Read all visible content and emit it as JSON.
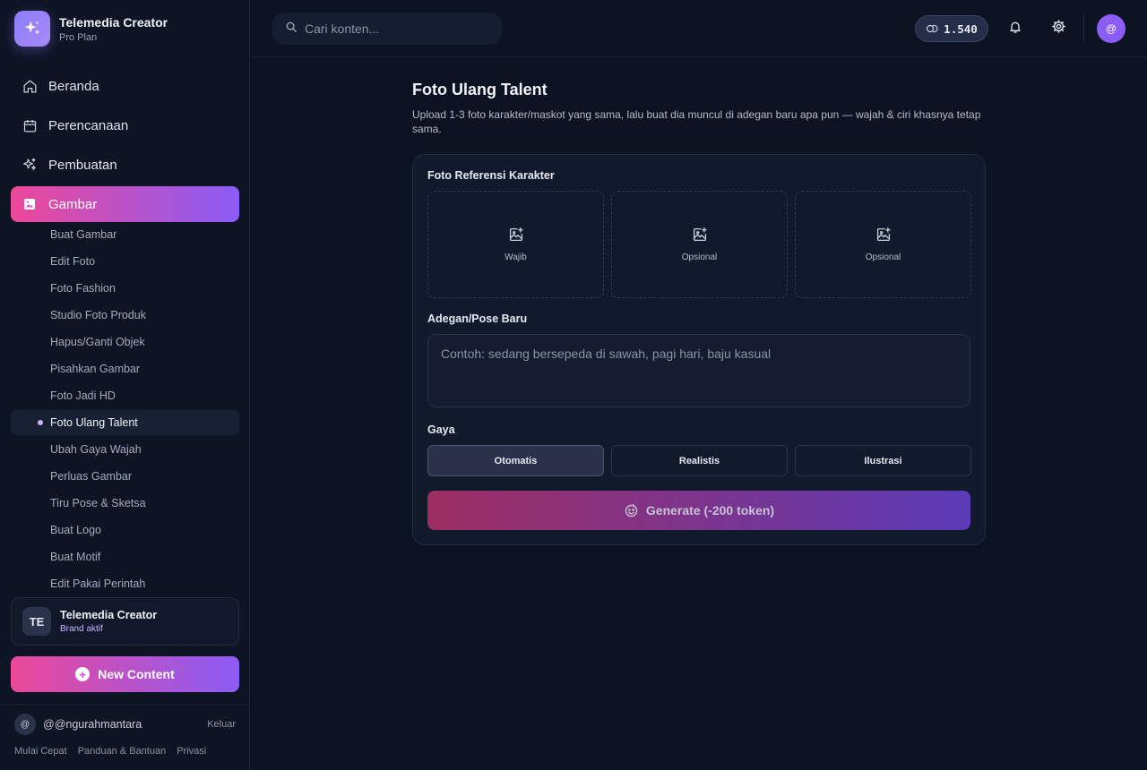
{
  "brand": {
    "name": "Telemedia Creator",
    "plan": "Pro Plan"
  },
  "nav": [
    {
      "label": "Beranda",
      "icon": "home-icon"
    },
    {
      "label": "Perencanaan",
      "icon": "calendar-icon"
    },
    {
      "label": "Pembuatan",
      "icon": "sparkles-icon"
    },
    {
      "label": "Gambar",
      "icon": "image-icon",
      "active": true
    }
  ],
  "subnav": [
    "Buat Gambar",
    "Edit Foto",
    "Foto Fashion",
    "Studio Foto Produk",
    "Hapus/Ganti Objek",
    "Pisahkan Gambar",
    "Foto Jadi HD",
    "Foto Ulang Talent",
    "Ubah Gaya Wajah",
    "Perluas Gambar",
    "Tiru Pose & Sketsa",
    "Buat Logo",
    "Buat Motif",
    "Edit Pakai Perintah"
  ],
  "subnav_active": "Foto Ulang Talent",
  "brand_card": {
    "initials": "TE",
    "name": "Telemedia Creator",
    "status": "Brand aktif"
  },
  "new_content": "New Content",
  "user": {
    "avatar": "@",
    "handle": "@@ngurahmantara",
    "logout": "Keluar"
  },
  "footer_links": [
    "Mulai Cepat",
    "Panduan & Bantuan",
    "Privasi"
  ],
  "search": {
    "placeholder": "Cari konten..."
  },
  "tokens": "1.540",
  "top_avatar": "@",
  "page": {
    "title": "Foto Ulang Talent",
    "description": "Upload 1-3 foto karakter/maskot yang sama, lalu buat dia muncul di adegan baru apa pun — wajah & ciri khasnya tetap sama."
  },
  "form": {
    "ref_label": "Foto Referensi Karakter",
    "slots": [
      "Wajib",
      "Opsional",
      "Opsional"
    ],
    "scene_label": "Adegan/Pose Baru",
    "scene_placeholder": "Contoh: sedang bersepeda di sawah, pagi hari, baju kasual",
    "style_label": "Gaya",
    "styles": [
      "Otomatis",
      "Realistis",
      "Ilustrasi"
    ],
    "style_selected": "Otomatis",
    "generate_label": "Generate (-200 token)"
  },
  "colors": {
    "accent_start": "#ec4899",
    "accent_end": "#8b5cf6",
    "background": "#0b1222"
  }
}
